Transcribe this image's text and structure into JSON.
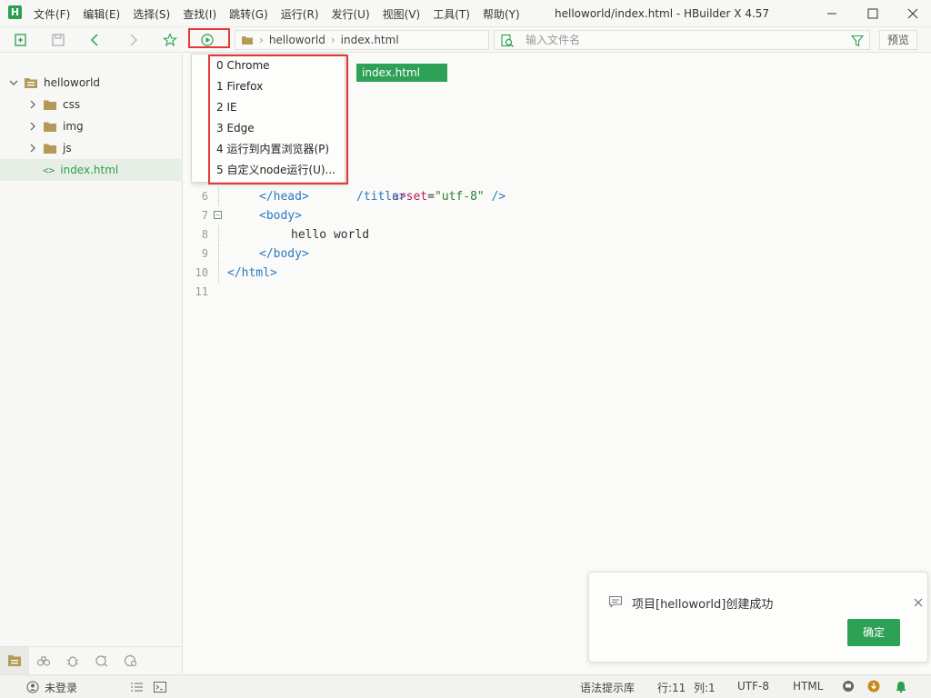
{
  "window": {
    "title": "helloworld/index.html - HBuilder X 4.57",
    "logo_letter": "H"
  },
  "menu": [
    "文件(F)",
    "编辑(E)",
    "选择(S)",
    "查找(I)",
    "跳转(G)",
    "运行(R)",
    "发行(U)",
    "视图(V)",
    "工具(T)",
    "帮助(Y)"
  ],
  "toolbar": {
    "breadcrumb": [
      "helloworld",
      "index.html"
    ],
    "search_placeholder": "输入文件名",
    "preview_label": "预览"
  },
  "sidebar": {
    "project": "helloworld",
    "items": [
      {
        "label": "css",
        "type": "folder"
      },
      {
        "label": "img",
        "type": "folder"
      },
      {
        "label": "js",
        "type": "folder"
      },
      {
        "label": "index.html",
        "type": "file",
        "selected": true
      }
    ]
  },
  "editor": {
    "tab_label": "index.html",
    "visible_lines": [
      {
        "num": "6",
        "indent": 1,
        "parts": [
          {
            "cls": "tag",
            "t": "</head>"
          }
        ]
      },
      {
        "num": "7",
        "indent": 1,
        "fold": true,
        "parts": [
          {
            "cls": "tag",
            "t": "<body>"
          }
        ]
      },
      {
        "num": "8",
        "indent": 2,
        "parts": [
          {
            "cls": "txt",
            "t": "hello world"
          }
        ]
      },
      {
        "num": "9",
        "indent": 1,
        "parts": [
          {
            "cls": "tag",
            "t": "</body>"
          }
        ]
      },
      {
        "num": "10",
        "indent": 0,
        "parts": [
          {
            "cls": "tag",
            "t": "</html>"
          }
        ]
      },
      {
        "num": "11",
        "indent": 0,
        "parts": []
      }
    ],
    "partial_line_4": {
      "attr": "arset",
      "eq": "=",
      "str": "\"utf-8\"",
      "close": " />"
    },
    "partial_line_5": "/title>"
  },
  "run_menu": {
    "items": [
      "0  Chrome",
      "1  Firefox",
      "2  IE",
      "3  Edge",
      "4  运行到内置浏览器(P)",
      "5 自定义node运行(U)..."
    ]
  },
  "notification": {
    "message": "项目[helloworld]创建成功",
    "ok_label": "确定"
  },
  "status": {
    "login": "未登录",
    "syntax_hint": "语法提示库",
    "line": "行:11",
    "col": "列:1",
    "encoding": "UTF-8",
    "language": "HTML"
  },
  "colors": {
    "accent": "#2da156",
    "highlight_red": "#e53935"
  }
}
